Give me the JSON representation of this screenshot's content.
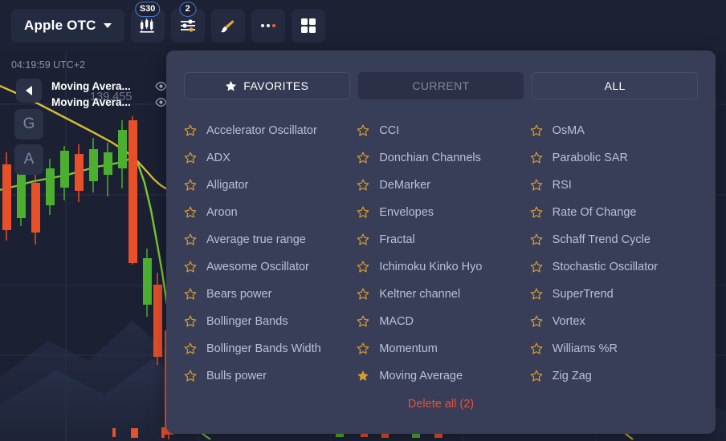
{
  "toolbar": {
    "asset": {
      "label": "Apple OTC",
      "icon": "chevron-down-icon"
    },
    "buttons": [
      {
        "name": "candles-chart-type-button",
        "icon": "candlestick-icon",
        "badge": "S30"
      },
      {
        "name": "indicators-button",
        "icon": "sliders-icon",
        "badge": "2"
      },
      {
        "name": "drawing-tools-button",
        "icon": "brush-icon",
        "badge": ""
      },
      {
        "name": "more-options-button",
        "icon": "ellipsis-icon",
        "badge": ""
      },
      {
        "name": "layout-grid-button",
        "icon": "grid-four-icon",
        "badge": ""
      }
    ]
  },
  "chart": {
    "time_label": "04:19:59 UTC+2",
    "price_label": "139.455",
    "collapse_arrow_icon": "chevron-left-icon",
    "left_buttons": [
      {
        "name": "grid-toggle-button",
        "label": "G"
      },
      {
        "name": "autoscale-toggle-button",
        "label": "A"
      }
    ],
    "indicator_labels": [
      {
        "name": "Moving Avera...",
        "visibility_icon": "eye-icon"
      },
      {
        "name": "Moving Avera...",
        "visibility_icon": "eye-icon"
      }
    ],
    "colors": {
      "bull": "#4caf2f",
      "bear": "#e8502a",
      "ma_yellow": "#d7b93a",
      "ma_green": "#7dc832",
      "background": "#1b2033",
      "grid": "#2a3048"
    }
  },
  "panel": {
    "tabs": [
      {
        "label": "FAVORITES",
        "state": "active",
        "icon": "star-filled-icon"
      },
      {
        "label": "CURRENT",
        "state": "dim",
        "icon": ""
      },
      {
        "label": "ALL",
        "state": "normal",
        "icon": ""
      }
    ],
    "columns": [
      [
        {
          "label": "Accelerator Oscillator",
          "favorite": false
        },
        {
          "label": "ADX",
          "favorite": false
        },
        {
          "label": "Alligator",
          "favorite": false
        },
        {
          "label": "Aroon",
          "favorite": false
        },
        {
          "label": "Average true range",
          "favorite": false
        },
        {
          "label": "Awesome Oscillator",
          "favorite": false
        },
        {
          "label": "Bears power",
          "favorite": false
        },
        {
          "label": "Bollinger Bands",
          "favorite": false
        },
        {
          "label": "Bollinger Bands Width",
          "favorite": false
        },
        {
          "label": "Bulls power",
          "favorite": false
        }
      ],
      [
        {
          "label": "CCI",
          "favorite": false
        },
        {
          "label": "Donchian Channels",
          "favorite": false
        },
        {
          "label": "DeMarker",
          "favorite": false
        },
        {
          "label": "Envelopes",
          "favorite": false
        },
        {
          "label": "Fractal",
          "favorite": false
        },
        {
          "label": "Ichimoku Kinko Hyo",
          "favorite": false
        },
        {
          "label": "Keltner channel",
          "favorite": false
        },
        {
          "label": "MACD",
          "favorite": false
        },
        {
          "label": "Momentum",
          "favorite": false
        },
        {
          "label": "Moving Average",
          "favorite": true
        }
      ],
      [
        {
          "label": "OsMA",
          "favorite": false
        },
        {
          "label": "Parabolic SAR",
          "favorite": false
        },
        {
          "label": "RSI",
          "favorite": false
        },
        {
          "label": "Rate Of Change",
          "favorite": false
        },
        {
          "label": "Schaff Trend Cycle",
          "favorite": false
        },
        {
          "label": "Stochastic Oscillator",
          "favorite": false
        },
        {
          "label": "SuperTrend",
          "favorite": false
        },
        {
          "label": "Vortex",
          "favorite": false
        },
        {
          "label": "Williams %R",
          "favorite": false
        },
        {
          "label": "Zig Zag",
          "favorite": false
        }
      ]
    ],
    "delete_all": "Delete all (2)",
    "colors": {
      "panel_bg": "#383e58",
      "star": "#d99b2e",
      "delete": "#e4513a"
    }
  }
}
